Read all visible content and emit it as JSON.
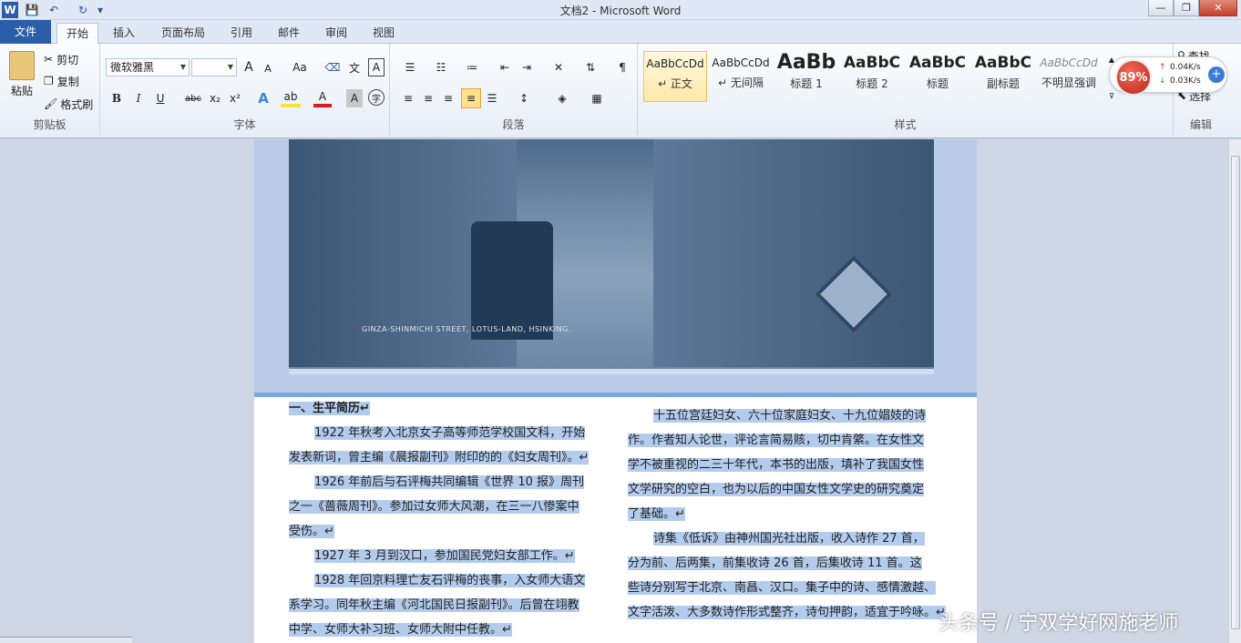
{
  "window": {
    "title": "文档2 - Microsoft Word",
    "minimize_glyph": "—",
    "maximize_glyph": "❐",
    "close_glyph": "✕"
  },
  "quick_access": {
    "app_icon": "W",
    "save_icon": "💾",
    "undo_icon": "↶",
    "redo_icon": "↻",
    "customize_icon": "▾"
  },
  "tabs": [
    {
      "label": "文件"
    },
    {
      "label": "开始"
    },
    {
      "label": "插入"
    },
    {
      "label": "页面布局"
    },
    {
      "label": "引用"
    },
    {
      "label": "邮件"
    },
    {
      "label": "审阅"
    },
    {
      "label": "视图"
    }
  ],
  "clipboard": {
    "paste_label": "粘贴",
    "cut_label": "剪切",
    "copy_label": "复制",
    "format_painter_label": "格式刷",
    "group_label": "剪贴板"
  },
  "font": {
    "font_name": "微软雅黑",
    "font_size": "",
    "grow_label": "A",
    "shrink_label": "A",
    "case_label": "Aa",
    "bold_label": "B",
    "italic_label": "I",
    "underline_label": "U",
    "strike_label": "abc",
    "subscript_label": "x₂",
    "superscript_label": "x²",
    "group_label": "字体"
  },
  "paragraph": {
    "group_label": "段落"
  },
  "styles": {
    "items": [
      {
        "sample": "AaBbCcDd",
        "name": "↵ 正文"
      },
      {
        "sample": "AaBbCcDd",
        "name": "↵ 无间隔"
      },
      {
        "sample": "AaBb",
        "name": "标题 1"
      },
      {
        "sample": "AaBbC",
        "name": "标题 2"
      },
      {
        "sample": "AaBbC",
        "name": "标题"
      },
      {
        "sample": "AaBbC",
        "name": "副标题"
      },
      {
        "sample": "AaBbCcDd",
        "name": "不明显强调"
      }
    ],
    "group_label": "样式"
  },
  "editing": {
    "find_label": "查找",
    "select_label": "选择",
    "group_label": "编辑"
  },
  "net_widget": {
    "cpu_percent": "89%",
    "upload": "0.04K/s",
    "download": "0.03K/s"
  },
  "document": {
    "photo_caption": "GINZA-SHINMICHI STREET, LOTUS-LAND, HSINKING.",
    "left_lines": [
      "一、生平简历↵",
      "1922 年秋考入北京女子高等师范学校国文科，开始",
      "发表新词，曾主编《晨报副刊》附印的的《妇女周刊》。↵",
      "1926 年前后与石评梅共同编辑《世界 10 报》周刊",
      "之一《蔷薇周刊》。参加过女师大风潮，在三一八惨案中",
      "受伤。↵",
      "1927 年 3 月到汉口，参加国民党妇女部工作。↵",
      "1928 年回京料理亡友石评梅的丧事，入女师大语文",
      "系学习。同年秋主编《河北国民日报副刊》。后曾在翊教",
      "中学、女师大补习班、女师大附中任教。↵"
    ],
    "right_lines": [
      "十五位宫廷妇女、六十位家庭妇女、十九位娼妓的诗",
      "作。作者知人论世，评论言简易赅，切中肯綮。在女性文",
      "学不被重视的二三十年代，本书的出版，填补了我国女性",
      "文学研究的空白，也为以后的中国女性文学史的研究奠定",
      "了基础。↵",
      "诗集《低诉》由神州国光社出版，收入诗作 27 首，",
      "分为前、后两集，前集收诗 26 首，后集收诗 11 首。这",
      "些诗分别写于北京、南昌、汉口。集子中的诗、感情激越、",
      "文字活泼、大多数诗作形式整齐，诗句押韵，适宜于吟咏。↵"
    ]
  },
  "watermark": "头条号 / 宁双学好网施老师"
}
